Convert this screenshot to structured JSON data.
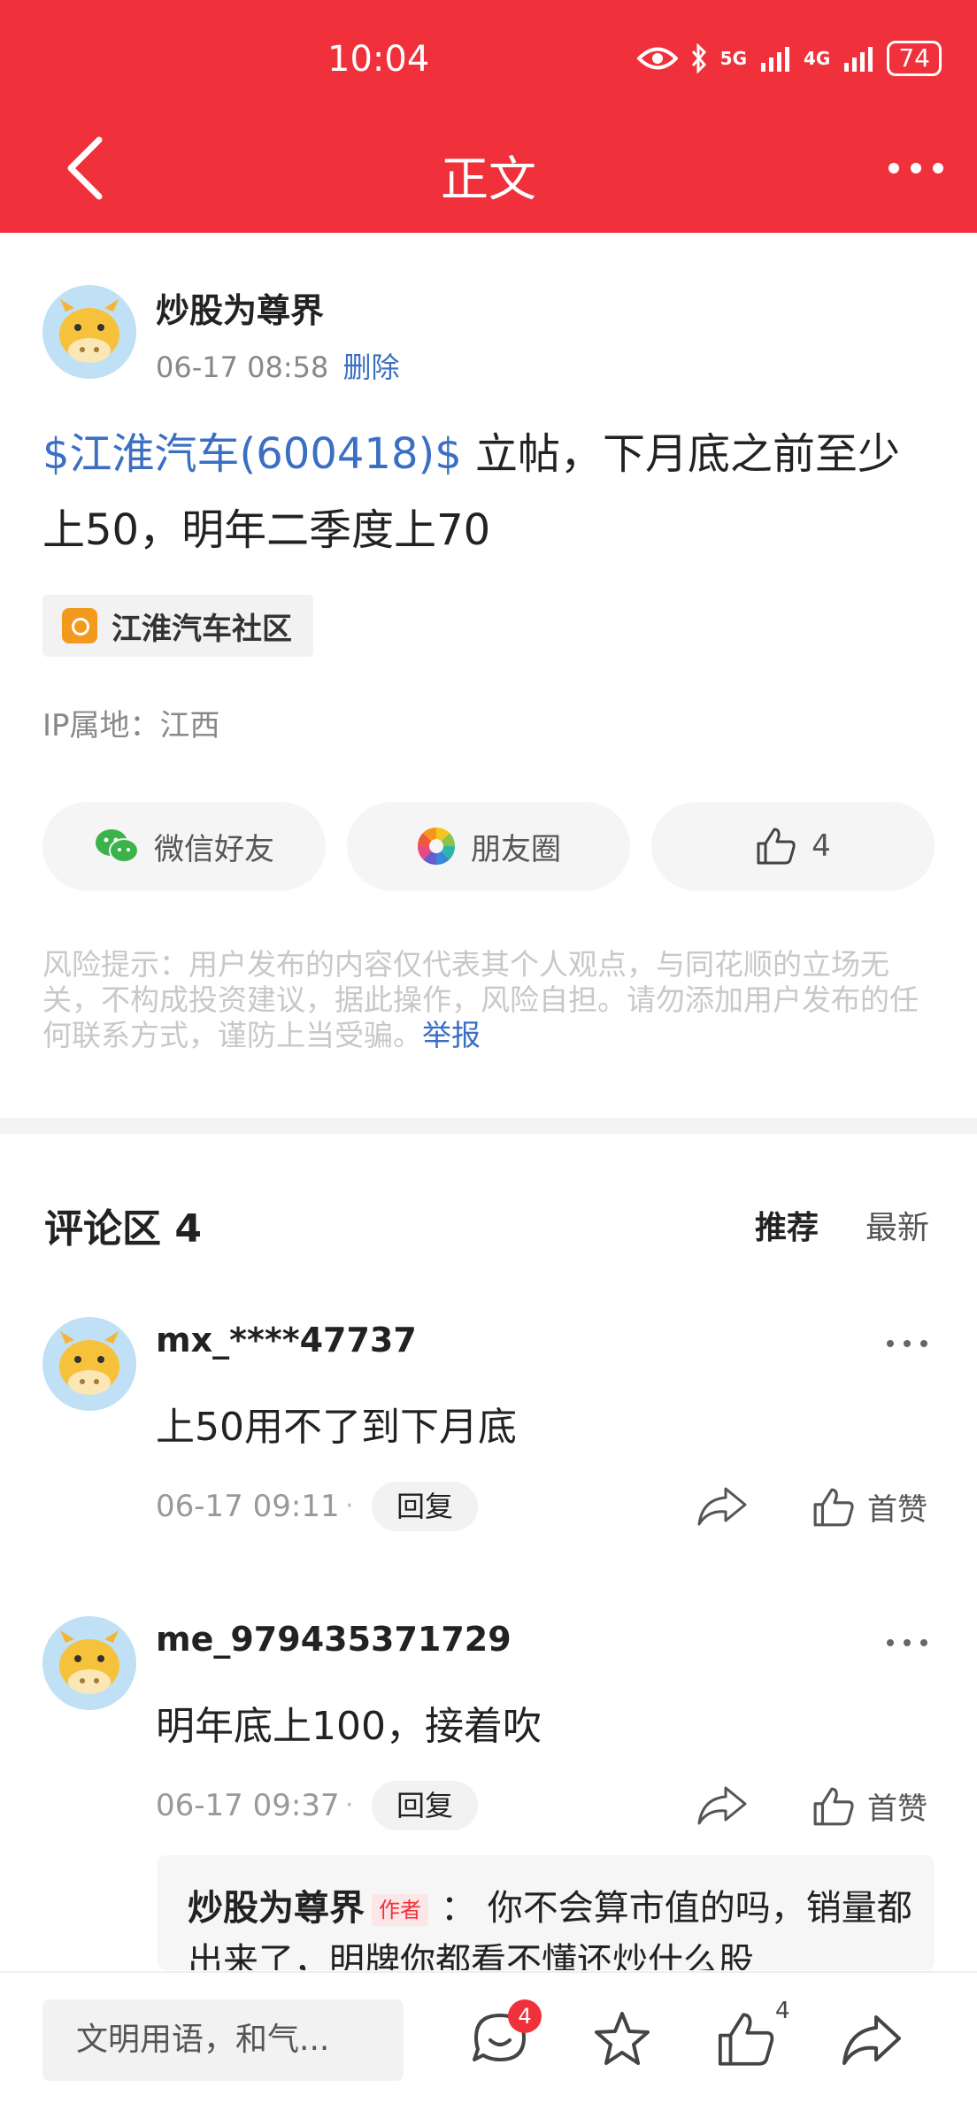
{
  "status_bar": {
    "time": "10:04",
    "signal_5g": "5G",
    "signal_4g": "4G",
    "battery": "74"
  },
  "header": {
    "title": "正文"
  },
  "post": {
    "author": "炒股为尊界",
    "time": "06-17 08:58",
    "delete_label": "删除",
    "stock_link": "$江淮汽车(600418)$",
    "text": " 立帖，下月底之前至少上50，明年二季度上70",
    "community": "江淮汽车社区",
    "ip_location": "IP属地：江西"
  },
  "share": {
    "wechat": "微信好友",
    "moments": "朋友圈",
    "like_count": "4"
  },
  "risk_notice": {
    "text": "风险提示：用户发布的内容仅代表其个人观点，与同花顺的立场无关，不构成投资建议，据此操作，风险自担。请勿添加用户发布的任何联系方式，谨防上当受骗。",
    "report_label": "举报"
  },
  "comments_section": {
    "title": "评论区 4",
    "sort_recommend": "推荐",
    "sort_latest": "最新"
  },
  "comments": [
    {
      "user": "mx_****47737",
      "text": "上50用不了到下月底",
      "time": "06-17 09:11",
      "dot": "·",
      "reply_label": "回复",
      "like_label": "首赞"
    },
    {
      "user": "me_979435371729",
      "text": "明年底上100，接着吹",
      "time": "06-17 09:37",
      "dot": "·",
      "reply_label": "回复",
      "like_label": "首赞"
    }
  ],
  "nested_reply": {
    "author": "炒股为尊界",
    "badge": "作者",
    "separator": "：",
    "text": "你不会算市值的吗，销量都出来了，明牌你都看不懂还炒什么股"
  },
  "bottom_bar": {
    "input_placeholder": "文明用语，和气...",
    "comment_badge": "4",
    "like_count": "4"
  },
  "colors": {
    "brand_red": "#f0303a",
    "link_blue": "#3a6fc4"
  }
}
